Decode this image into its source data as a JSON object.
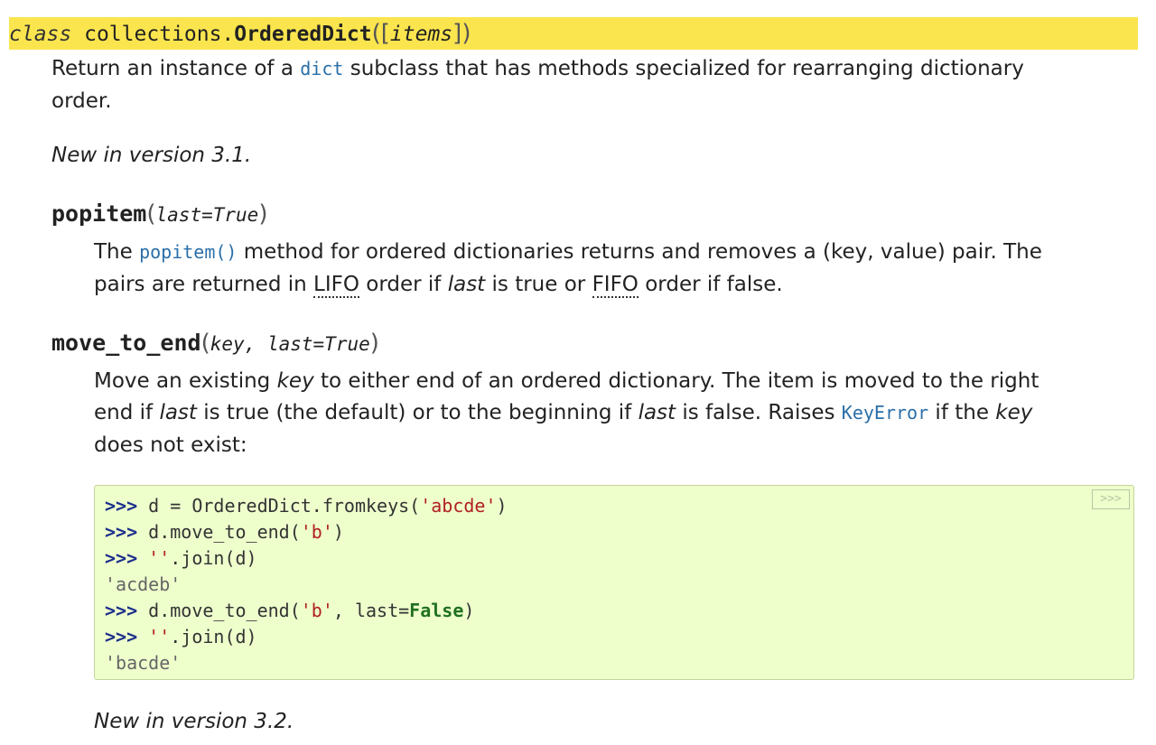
{
  "class_sig": {
    "keyword": "class",
    "prefix": "collections.",
    "name": "OrderedDict",
    "open_paren": "(",
    "opt_open": "[",
    "param": "items",
    "opt_close": "]",
    "close_paren": ")",
    "highlight_color": "#fbe54e"
  },
  "class_desc": {
    "pre": "Return an instance of a ",
    "link": "dict",
    "post": " subclass that has methods specialized for rearranging dictionary",
    "line2": "order."
  },
  "class_version": "New in version 3.1.",
  "popitem": {
    "name": "popitem",
    "open_paren": "(",
    "param": "last=True",
    "close_paren": ")",
    "desc_l1_pre": "The ",
    "desc_l1_link": "popitem()",
    "desc_l1_post": " method for ordered dictionaries returns and removes a (key, value) pair. The",
    "desc_l2_a": "pairs are returned in ",
    "desc_l2_lifo": "LIFO",
    "desc_l2_b": " order if ",
    "desc_l2_last": "last",
    "desc_l2_c": " is true or ",
    "desc_l2_fifo": "FIFO",
    "desc_l2_d": " order if false."
  },
  "move_to_end": {
    "name": "move_to_end",
    "open_paren": "(",
    "param1": "key",
    "sep": ", ",
    "param2": "last=True",
    "close_paren": ")",
    "l1_a": "Move an existing ",
    "l1_key": "key",
    "l1_b": " to either end of an ordered dictionary. The item is moved to the right",
    "l2_a": "end if ",
    "l2_last": "last",
    "l2_b": " is true (the default) or to the beginning if ",
    "l2_last2": "last",
    "l2_c": " is false. Raises ",
    "l2_link": "KeyError",
    "l2_d": " if the ",
    "l2_key": "key",
    "l3": "does not exist:"
  },
  "code": {
    "copy_label": ">>>",
    "lines": [
      {
        "prompt": ">>>",
        "a": " d = OrderedDict.fromkeys(",
        "s": "'abcde'",
        "b": ")"
      },
      {
        "prompt": ">>>",
        "a": " d.move_to_end(",
        "s": "'b'",
        "b": ")"
      },
      {
        "prompt": ">>>",
        "a": " ",
        "s": "''",
        "b": ".join(d)"
      },
      {
        "output": "'acdeb'"
      },
      {
        "prompt": ">>>",
        "a": " d.move_to_end(",
        "s": "'b'",
        "b": ", last=",
        "kc": "False",
        "c": ")"
      },
      {
        "prompt": ">>>",
        "a": " ",
        "s": "''",
        "b": ".join(d)"
      },
      {
        "output": "'bacde'"
      }
    ]
  },
  "move_version": "New in version 3.2."
}
